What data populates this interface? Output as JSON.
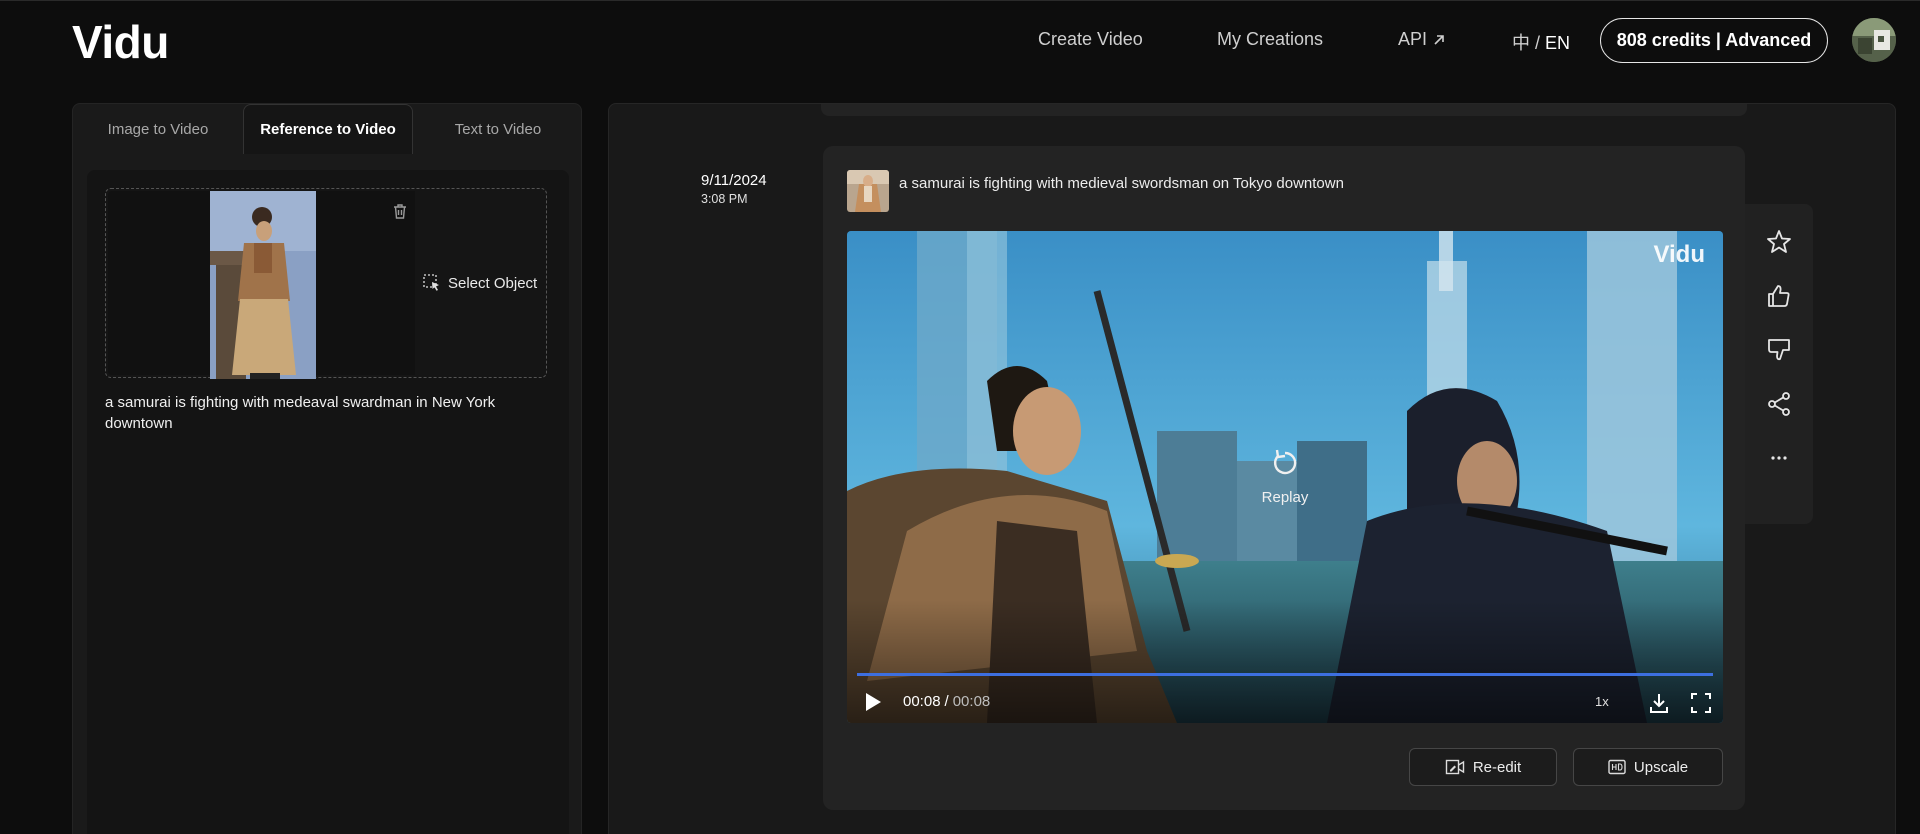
{
  "header": {
    "logo": "Vidu",
    "nav": {
      "create_video": "Create Video",
      "my_creations": "My Creations",
      "api": "API"
    },
    "lang": {
      "zh": "中",
      "sep": " / ",
      "en": "EN"
    },
    "credits_label": "808 credits | Advanced"
  },
  "left_panel": {
    "tabs": [
      {
        "label": "Image to Video",
        "active": false
      },
      {
        "label": "Reference to Video",
        "active": true
      },
      {
        "label": "Text to Video",
        "active": false
      }
    ],
    "select_object_label": "Select Object",
    "prompt": "a samurai is fighting with medeaval swardman in New York downtown"
  },
  "generation": {
    "date": "9/11/2024",
    "time": "3:08 PM",
    "prompt": "a samurai is fighting with medieval swordsman on Tokyo downtown",
    "video": {
      "watermark": "Vidu",
      "replay_label": "Replay",
      "current_time": "00:08",
      "time_separator": "/",
      "total_time": "00:08",
      "progress": 1.0,
      "speed": "1x"
    },
    "buttons": {
      "reedit": "Re-edit",
      "upscale": "Upscale"
    }
  },
  "colors": {
    "accent_progress": "#3d6fe0",
    "background": "#0d0d0d",
    "panel": "#191919"
  }
}
